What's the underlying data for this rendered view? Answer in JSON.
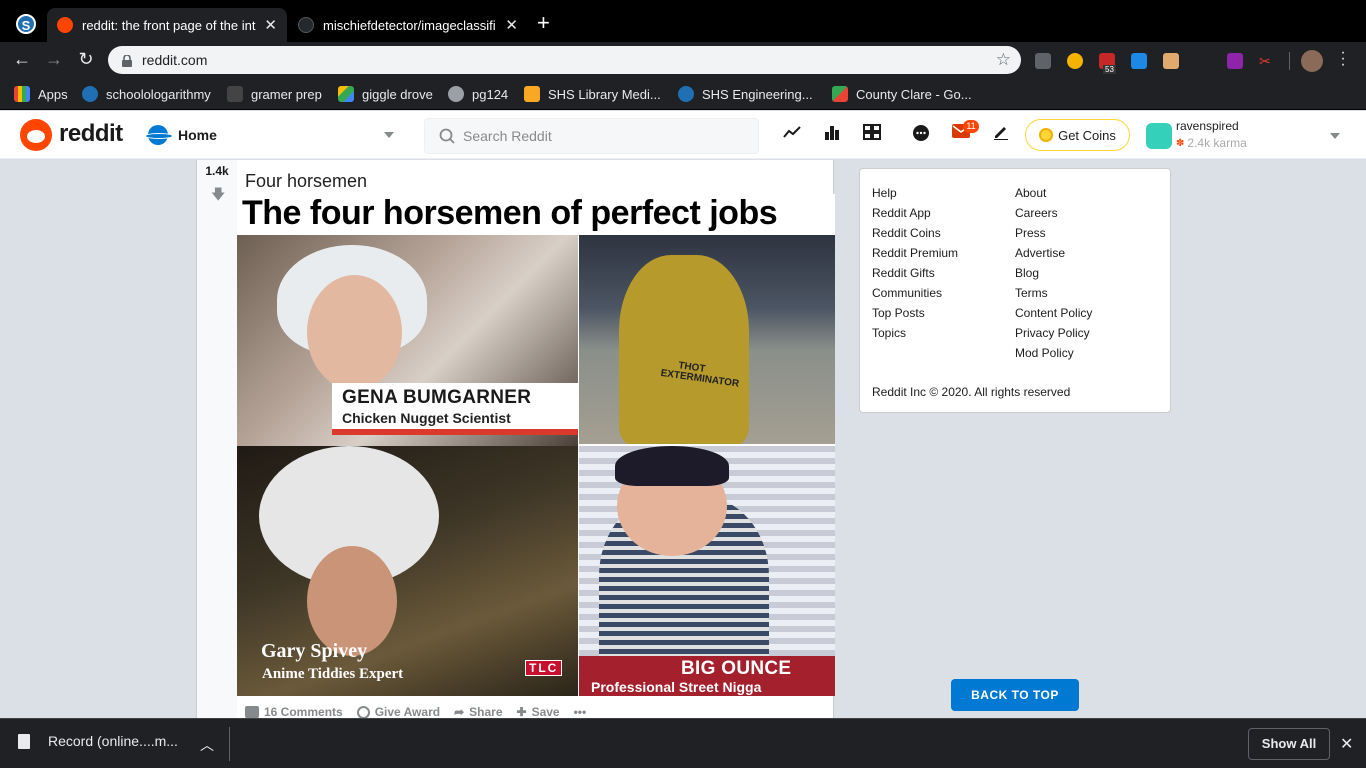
{
  "browser": {
    "tabs": [
      {
        "title": "reddit: the front page of the int",
        "active": true,
        "favicon": "reddit-icon",
        "color": "#ff4500"
      },
      {
        "title": "mischiefdetector/imageclassifi",
        "active": false,
        "favicon": "github-icon",
        "color": "#24292e"
      }
    ],
    "url": "reddit.com",
    "bookmarks": [
      {
        "label": "Apps",
        "icon": "apps-grid-icon",
        "color": "#ea4335"
      },
      {
        "label": "schoolologarithmy",
        "icon": "schoology-icon",
        "color": "#1f6fb2"
      },
      {
        "label": "gramer prep",
        "icon": "gb-icon",
        "color": "#444444"
      },
      {
        "label": "giggle drove",
        "icon": "google-drive-icon",
        "color": "#fbbc04"
      },
      {
        "label": "pg124",
        "icon": "globe-icon",
        "color": "#9aa0a6"
      },
      {
        "label": "SHS Library Medi...",
        "icon": "library-icon",
        "color": "#f9a825"
      },
      {
        "label": "SHS Engineering...",
        "icon": "schoology-icon",
        "color": "#1f6fb2"
      },
      {
        "label": "County Clare - Go...",
        "icon": "maps-icon",
        "color": "#34a853"
      }
    ],
    "extension_badge": "53"
  },
  "reddit_header": {
    "logo_text": "reddit",
    "feed_label": "Home",
    "search_placeholder": "Search Reddit",
    "mail_badge": "11",
    "coins_label": "Get Coins",
    "username": "ravenspired",
    "karma": "2.4k karma"
  },
  "post": {
    "score": "1.4k",
    "title": "Four horsemen",
    "image_caption": "The four horsemen of perfect jobs",
    "panels": {
      "p1_name": "GENA BUMGARNER",
      "p1_role": "Chicken Nugget Scientist",
      "p2_text": "THOT EXTERMINATOR",
      "p3_name": "Gary Spivey",
      "p3_role": "Anime Tiddies Expert",
      "p3_network": "TLC",
      "p4_name": "BIG OUNCE",
      "p4_role": "Professional Street Nigga"
    },
    "actions": {
      "comments": "16 Comments",
      "award": "Give Award",
      "share": "Share",
      "save": "Save",
      "more": "•••"
    }
  },
  "sidebar": {
    "col1": [
      "Help",
      "Reddit App",
      "Reddit Coins",
      "Reddit Premium",
      "Reddit Gifts",
      "Communities",
      "Top Posts",
      "Topics"
    ],
    "col2": [
      "About",
      "Careers",
      "Press",
      "Advertise",
      "Blog",
      "Terms",
      "Content Policy",
      "Privacy Policy",
      "Mod Policy"
    ],
    "copyright": "Reddit Inc © 2020. All rights reserved",
    "back_to_top": "BACK TO TOP"
  },
  "downloads": {
    "item": "Record (online....m...",
    "show_all": "Show All"
  }
}
